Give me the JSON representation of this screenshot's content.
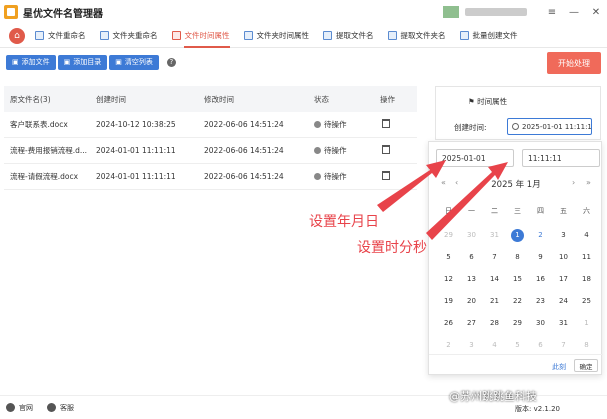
{
  "app": {
    "title": "星优文件名管理器"
  },
  "window": {
    "menu": "≡",
    "minimize": "—",
    "close": "✕"
  },
  "tabs": [
    {
      "label": "文件重命名"
    },
    {
      "label": "文件夹重命名"
    },
    {
      "label": "文件时间属性"
    },
    {
      "label": "文件夹时间属性"
    },
    {
      "label": "提取文件名"
    },
    {
      "label": "提取文件夹名"
    },
    {
      "label": "批量创建文件"
    }
  ],
  "toolbar": {
    "add_file": "添加文件",
    "add_folder": "添加目录",
    "clear": "清空列表",
    "help": "?",
    "start": "开始处理"
  },
  "table": {
    "headers": [
      "原文件名(3)",
      "创建时间",
      "修改时间",
      "状态",
      "操作"
    ],
    "rows": [
      {
        "name": "客户联系表.docx",
        "created": "2024-10-12 10:38:25",
        "modified": "2022-06-06 14:51:24",
        "status": "待操作"
      },
      {
        "name": "流程-费用报销流程.d...",
        "created": "2024-01-01 11:11:11",
        "modified": "2022-06-06 14:51:24",
        "status": "待操作"
      },
      {
        "name": "流程-请假流程.docx",
        "created": "2024-01-01 11:11:11",
        "modified": "2022-06-06 14:51:24",
        "status": "待操作"
      }
    ]
  },
  "right_panel": {
    "title": "时间属性",
    "created_label": "创建时间:",
    "created_value": "2025-01-01 11:11:11"
  },
  "picker": {
    "date": "2025-01-01",
    "time": "11:11:11",
    "nav_prev_year": "«",
    "nav_prev_month": "‹",
    "nav_next_month": "›",
    "nav_next_year": "»",
    "month_label": "2025 年  1月",
    "weekdays": [
      "日",
      "一",
      "二",
      "三",
      "四",
      "五",
      "六"
    ],
    "days": [
      "29",
      "30",
      "31",
      "1",
      "2",
      "3",
      "4",
      "5",
      "6",
      "7",
      "8",
      "9",
      "10",
      "11",
      "12",
      "13",
      "14",
      "15",
      "16",
      "17",
      "18",
      "19",
      "20",
      "21",
      "22",
      "23",
      "24",
      "25",
      "26",
      "27",
      "28",
      "29",
      "30",
      "31",
      "1",
      "2",
      "3",
      "4",
      "5",
      "6",
      "7",
      "8"
    ],
    "now": "此刻",
    "ok": "确定"
  },
  "annotations": {
    "a1": "设置年月日",
    "a2": "设置时分秒"
  },
  "status": {
    "website": "官网",
    "support": "客服",
    "version": "版本: v2.1.20"
  },
  "watermark": "@苏州跳跳鱼科技"
}
